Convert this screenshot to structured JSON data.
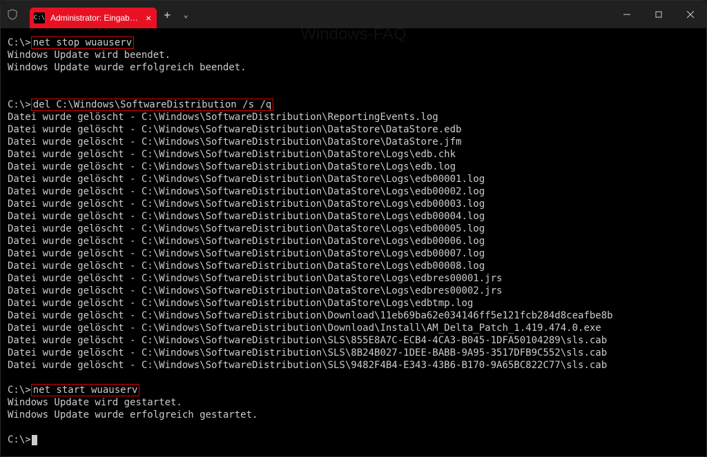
{
  "watermark": "Windows-FAQ",
  "titlebar": {
    "tab_icon_text": "C:\\",
    "tab_title": "Administrator: Eingabeauffor",
    "tab_close": "×",
    "new_tab": "+",
    "tab_dropdown": "⌄"
  },
  "terminal": {
    "prompt": "C:\\>",
    "cmd1": "net stop wuauserv",
    "out1a": "Windows Update wird beendet.",
    "out1b": "Windows Update wurde erfolgreich beendet.",
    "cmd2": "del C:\\Windows\\SoftwareDistribution /s /q",
    "del_prefix": "Datei wurde gelöscht - ",
    "files": [
      "C:\\Windows\\SoftwareDistribution\\ReportingEvents.log",
      "C:\\Windows\\SoftwareDistribution\\DataStore\\DataStore.edb",
      "C:\\Windows\\SoftwareDistribution\\DataStore\\DataStore.jfm",
      "C:\\Windows\\SoftwareDistribution\\DataStore\\Logs\\edb.chk",
      "C:\\Windows\\SoftwareDistribution\\DataStore\\Logs\\edb.log",
      "C:\\Windows\\SoftwareDistribution\\DataStore\\Logs\\edb00001.log",
      "C:\\Windows\\SoftwareDistribution\\DataStore\\Logs\\edb00002.log",
      "C:\\Windows\\SoftwareDistribution\\DataStore\\Logs\\edb00003.log",
      "C:\\Windows\\SoftwareDistribution\\DataStore\\Logs\\edb00004.log",
      "C:\\Windows\\SoftwareDistribution\\DataStore\\Logs\\edb00005.log",
      "C:\\Windows\\SoftwareDistribution\\DataStore\\Logs\\edb00006.log",
      "C:\\Windows\\SoftwareDistribution\\DataStore\\Logs\\edb00007.log",
      "C:\\Windows\\SoftwareDistribution\\DataStore\\Logs\\edb00008.log",
      "C:\\Windows\\SoftwareDistribution\\DataStore\\Logs\\edbres00001.jrs",
      "C:\\Windows\\SoftwareDistribution\\DataStore\\Logs\\edbres00002.jrs",
      "C:\\Windows\\SoftwareDistribution\\DataStore\\Logs\\edbtmp.log",
      "C:\\Windows\\SoftwareDistribution\\Download\\11eb69ba62e034146ff5e121fcb284d8ceafbe8b",
      "C:\\Windows\\SoftwareDistribution\\Download\\Install\\AM_Delta_Patch_1.419.474.0.exe",
      "C:\\Windows\\SoftwareDistribution\\SLS\\855E8A7C-ECB4-4CA3-B045-1DFA50104289\\sls.cab",
      "C:\\Windows\\SoftwareDistribution\\SLS\\8B24B027-1DEE-BABB-9A95-3517DFB9C552\\sls.cab",
      "C:\\Windows\\SoftwareDistribution\\SLS\\9482F4B4-E343-43B6-B170-9A65BC822C77\\sls.cab"
    ],
    "cmd3": "net start wuauserv",
    "out3a": "Windows Update wird gestartet.",
    "out3b": "Windows Update wurde erfolgreich gestartet."
  }
}
